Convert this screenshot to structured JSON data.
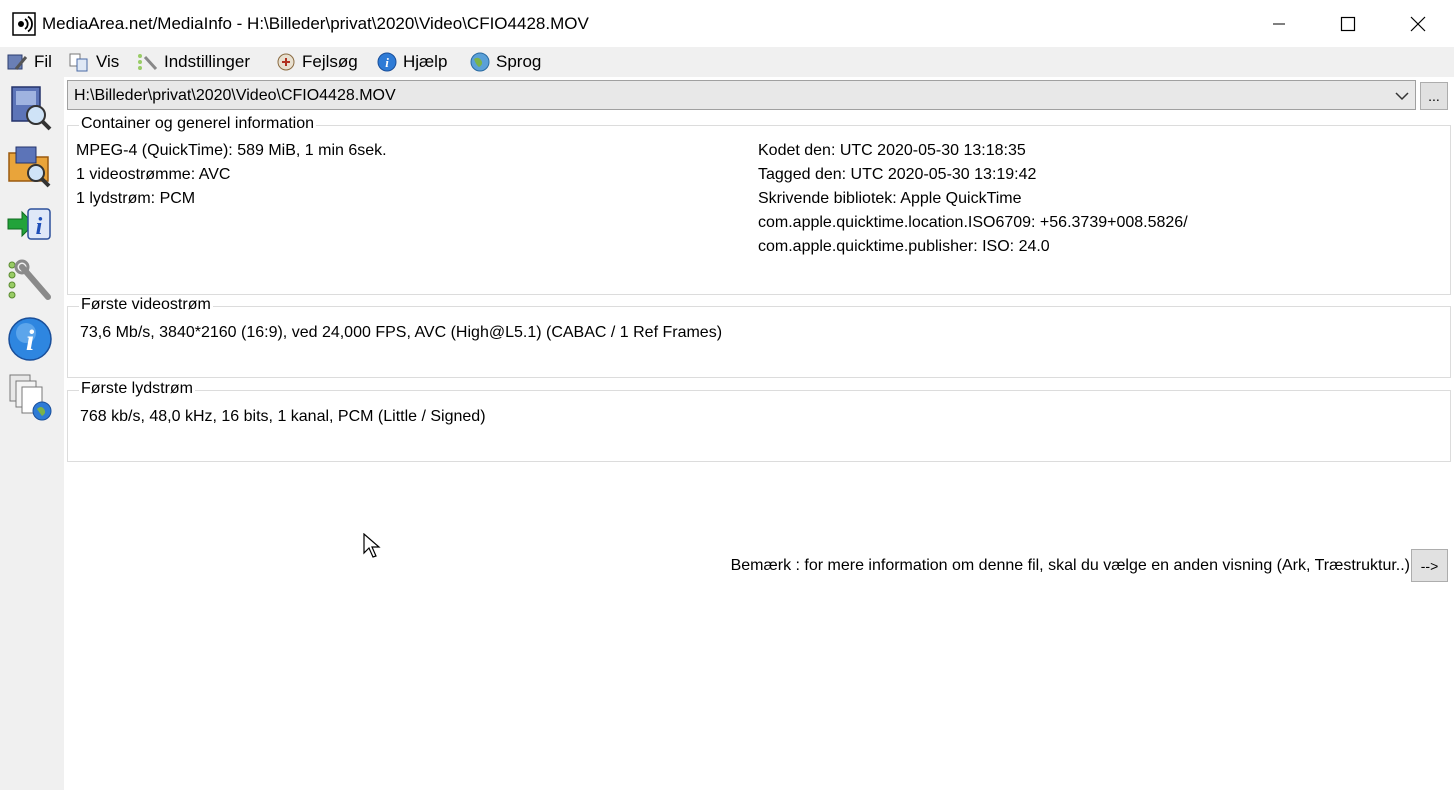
{
  "window": {
    "title": "MediaArea.net/MediaInfo - H:\\Billeder\\privat\\2020\\Video\\CFIO4428.MOV"
  },
  "menu": {
    "items": [
      {
        "label": "Fil",
        "icon": "file-tools-icon"
      },
      {
        "label": "Vis",
        "icon": "view-icon"
      },
      {
        "label": "Indstillinger",
        "icon": "settings-icon"
      },
      {
        "label": "Fejlsøg",
        "icon": "debug-icon"
      },
      {
        "label": "Hjælp",
        "icon": "help-icon"
      },
      {
        "label": "Sprog",
        "icon": "globe-icon"
      }
    ]
  },
  "toolbar": {
    "items": [
      "open-file-icon",
      "open-folder-icon",
      "export-info-icon",
      "preferences-icon",
      "about-icon",
      "knowledge-base-icon"
    ]
  },
  "file_selector": {
    "value": "H:\\Billeder\\privat\\2020\\Video\\CFIO4428.MOV",
    "browse_label": "..."
  },
  "general": {
    "title": "Container og generel information",
    "left_lines": [
      "MPEG-4 (QuickTime): 589 MiB, 1 min 6sek.",
      "1 videostrømme: AVC",
      "1 lydstrøm: PCM"
    ],
    "right_lines": [
      "Kodet den: UTC 2020-05-30 13:18:35",
      "Tagged den: UTC 2020-05-30 13:19:42",
      "Skrivende bibliotek: Apple QuickTime",
      "com.apple.quicktime.location.ISO6709: +56.3739+008.5826/",
      "com.apple.quicktime.publisher: ISO: 24.0"
    ]
  },
  "video": {
    "title": "Første videostrøm",
    "line": "73,6 Mb/s, 3840*2160 (16:9), ved 24,000 FPS, AVC (High@L5.1) (CABAC / 1 Ref Frames)"
  },
  "audio": {
    "title": "Første lydstrøm",
    "line": "768 kb/s, 48,0 kHz, 16 bits, 1 kanal, PCM (Little / Signed)"
  },
  "note": {
    "text": "Bemærk : for mere information om denne fil, skal du vælge en anden visning (Ark, Træstruktur..)",
    "button_label": "-->"
  }
}
